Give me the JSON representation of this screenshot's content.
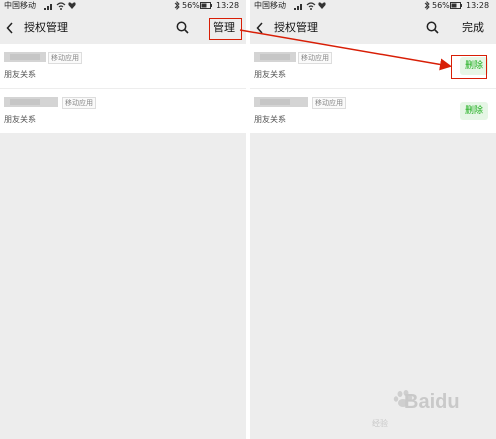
{
  "status_bar": {
    "carrier": "中国移动",
    "battery": "56%",
    "time": "13:28"
  },
  "left_panel": {
    "title": "授权管理",
    "action": "管理",
    "items": [
      {
        "tag": "移动应用",
        "subtitle": "朋友关系"
      },
      {
        "tag": "移动应用",
        "subtitle": "朋友关系"
      }
    ]
  },
  "right_panel": {
    "title": "授权管理",
    "action": "完成",
    "items": [
      {
        "tag": "移动应用",
        "subtitle": "朋友关系",
        "delete_label": "删除"
      },
      {
        "tag": "移动应用",
        "subtitle": "朋友关系",
        "delete_label": "删除"
      }
    ]
  },
  "watermark": {
    "text": "Baidu",
    "subtext": "经验"
  },
  "colors": {
    "accent": "#1aad19",
    "highlight": "#d81e06"
  },
  "icons": [
    "signal-icon",
    "wifi-icon",
    "heart-icon",
    "bluetooth-icon",
    "battery-icon",
    "back-arrow-icon",
    "search-icon",
    "baidu-paw-icon"
  ]
}
